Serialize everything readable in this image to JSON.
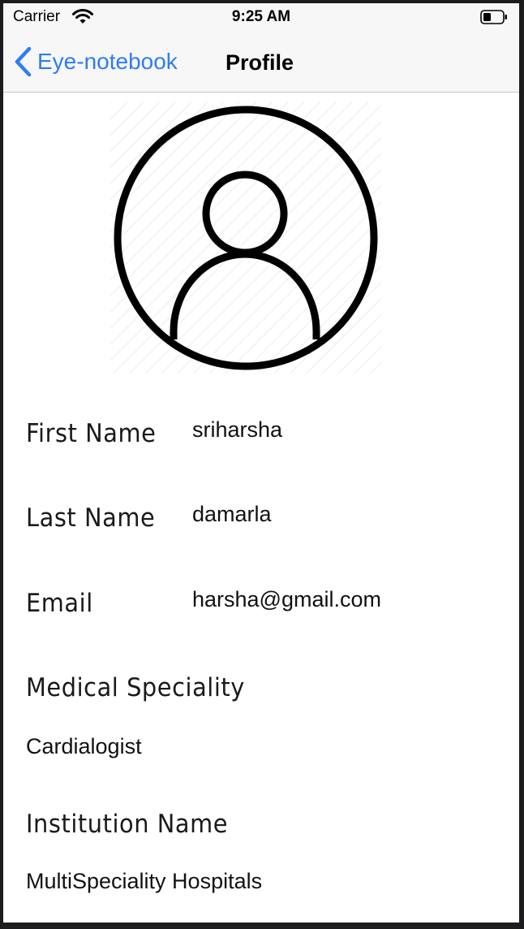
{
  "status_bar": {
    "carrier": "Carrier",
    "time": "9:25 AM",
    "wifi_icon": "wifi-icon",
    "battery_icon": "battery-icon"
  },
  "nav": {
    "back_label": "Eye-notebook",
    "title": "Profile",
    "accent_color": "#2f7cf6"
  },
  "avatar": {
    "icon": "user-avatar-icon"
  },
  "profile": {
    "first_name_label": "First Name",
    "first_name": "sriharsha",
    "last_name_label": "Last Name",
    "last_name": "damarla",
    "email_label": "Email",
    "email": "harsha@gmail.com",
    "speciality_label": "Medical Speciality",
    "speciality": "Cardialogist",
    "institution_label": "Institution Name",
    "institution": "MultiSpeciality Hospitals"
  }
}
